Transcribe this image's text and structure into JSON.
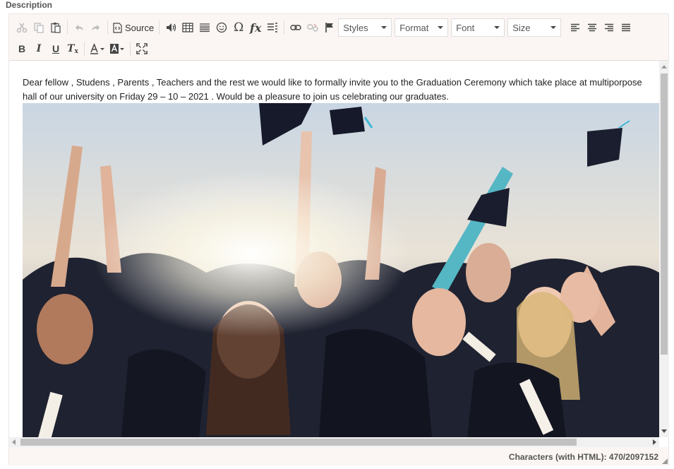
{
  "field": {
    "label": "Description"
  },
  "toolbar": {
    "source_label": "Source",
    "styles_label": "Styles",
    "format_label": "Format",
    "font_label": "Font",
    "size_label": "Size",
    "icons": [
      "cut-icon",
      "copy-icon",
      "paste-icon",
      "undo-icon",
      "redo-icon",
      "source-icon",
      "audio-icon",
      "table-icon",
      "horizontal-line-icon",
      "smiley-icon",
      "special-char-icon",
      "formula-icon",
      "insert-list-icon",
      "link-icon",
      "unlink-icon",
      "anchor-icon",
      "align-left-icon",
      "align-center-icon",
      "align-right-icon",
      "justify-icon",
      "bold-icon",
      "italic-icon",
      "underline-icon",
      "remove-format-icon",
      "text-color-icon",
      "background-color-icon",
      "maximize-icon"
    ]
  },
  "content": {
    "paragraph": "Dear fellow , Studens , Parents , Teachers and the rest we would like to formally invite you to the Graduation Ceremony which take place at multiporpose hall of our university on Friday 29 – 10 – 2021 . Would be a pleasure to join us celebrating our graduates."
  },
  "status": {
    "char_count": "Characters (with HTML): 470/2097152"
  },
  "colors": {
    "toolbar_bg": "#fbf6f3",
    "scroll_thumb": "#c1c1c1"
  }
}
